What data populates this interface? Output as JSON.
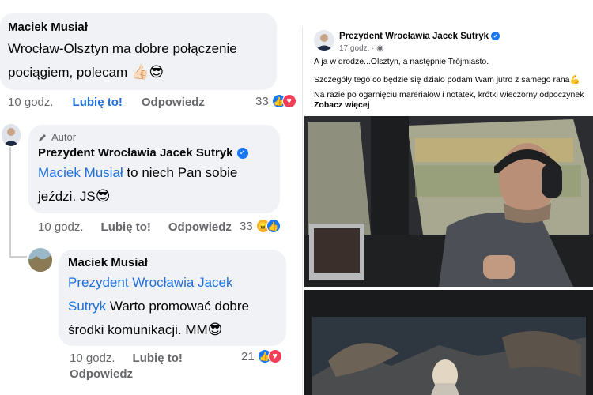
{
  "thread": {
    "comment1": {
      "author": "Maciek Musiał",
      "text_line1": "Wrocław-Olsztyn ma dobre połączenie",
      "text_line2": "pociągiem, polecam",
      "emojis": "👍🏻😎",
      "time": "10 godz.",
      "like_label": "Lubię to!",
      "reply_label": "Odpowiedz",
      "reaction_count": "33",
      "reaction_icons": [
        "like-icon",
        "heart-icon"
      ]
    },
    "reply1": {
      "badge": "Autor",
      "author": "Prezydent Wrocławia Jacek Sutryk",
      "mention": "Maciek Musiał",
      "text_line1": " to niech Pan sobie",
      "text_line2": "jeździ. JS",
      "emoji": "😎",
      "time": "10 godz.",
      "like_label": "Lubię to!",
      "reply_label": "Odpowiedz",
      "reaction_count": "33",
      "reaction_icons": [
        "angry-icon",
        "like-icon"
      ]
    },
    "reply2": {
      "author": "Maciek Musiał",
      "mention_line1": "Prezydent Wrocławia Jacek",
      "mention_line2": "Sutryk",
      "text_line2": "Warto promować dobre",
      "text_line3": "środki komunikacji. MM",
      "emoji": "😎",
      "time": "10 godz.",
      "like_label": "Lubię to!",
      "reply_label": "Odpowiedz",
      "reaction_count": "21",
      "reaction_icons": [
        "like-icon",
        "heart-icon"
      ]
    }
  },
  "post": {
    "author": "Prezydent Wrocławia Jacek Sutryk",
    "time": "17 godz.",
    "line1": "A ja w drodze...Olsztyn, a następnie Trójmiasto.",
    "line2": "Szczegóły tego co będzie się działo podam Wam jutro z samego rana",
    "line2_emoji": "💪",
    "line3": "Na razie po ogarnięciu mareriałów i notatek, krótki wieczorny odpoczynek",
    "see_more": "Zobacz więcej"
  },
  "colors": {
    "bubble": "#f0f2f5",
    "link": "#216fdb",
    "meta": "#65676b",
    "verified": "#1877f2"
  }
}
